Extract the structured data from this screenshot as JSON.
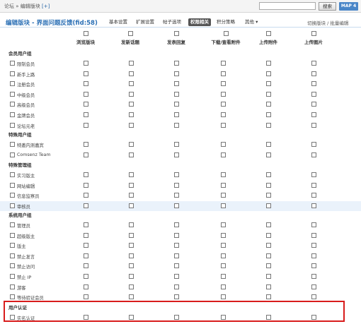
{
  "topbar": {
    "breadcrumb_home": "论坛",
    "breadcrumb_sep": "»",
    "breadcrumb_current": "编辑版块",
    "breadcrumb_add": "[+]",
    "search_value": "",
    "search_label": "搜索",
    "map_label": "MAP 4"
  },
  "header": {
    "title": "编辑版块 - 界面问题反馈(fid:58)",
    "tabs": [
      {
        "label": "基本设置",
        "active": false
      },
      {
        "label": "扩展设置",
        "active": false
      },
      {
        "label": "帖子选项",
        "active": false
      },
      {
        "label": "权限相关",
        "active": true
      },
      {
        "label": "积分策略",
        "active": false
      },
      {
        "label": "其他 ▾",
        "active": false
      }
    ],
    "switch_link": "切换版块 / 批量编辑"
  },
  "columns": [
    "浏览版块",
    "发新话题",
    "发表回复",
    "下载/查看附件",
    "上传附件",
    "上传图片"
  ],
  "groups": [
    {
      "title": "会员用户组",
      "rows": [
        "限制会员",
        "新手上路",
        "注册会员",
        "中级会员",
        "高级会员",
        "金牌会员",
        "论坛元老"
      ]
    },
    {
      "title": "特殊用户组",
      "rows": [
        "特邀内测嘉宾",
        "Comsenz Team"
      ]
    },
    {
      "title": "特殊管理组",
      "rows": [
        "实习版主",
        "网站编辑",
        "信息监察员",
        "审核员"
      ]
    },
    {
      "title": "系统用户组",
      "rows": [
        "管理员",
        "超级版主",
        "版主",
        "禁止发言",
        "禁止访问",
        "禁止 IP",
        "游客",
        "等待验证会员"
      ]
    },
    {
      "title": "用户认证",
      "rows": [
        "实名认证"
      ]
    }
  ],
  "colors": {
    "accent": "#2a6fb5",
    "highlight_border": "#d81c1c",
    "hover_row": "#eaf2fb"
  }
}
